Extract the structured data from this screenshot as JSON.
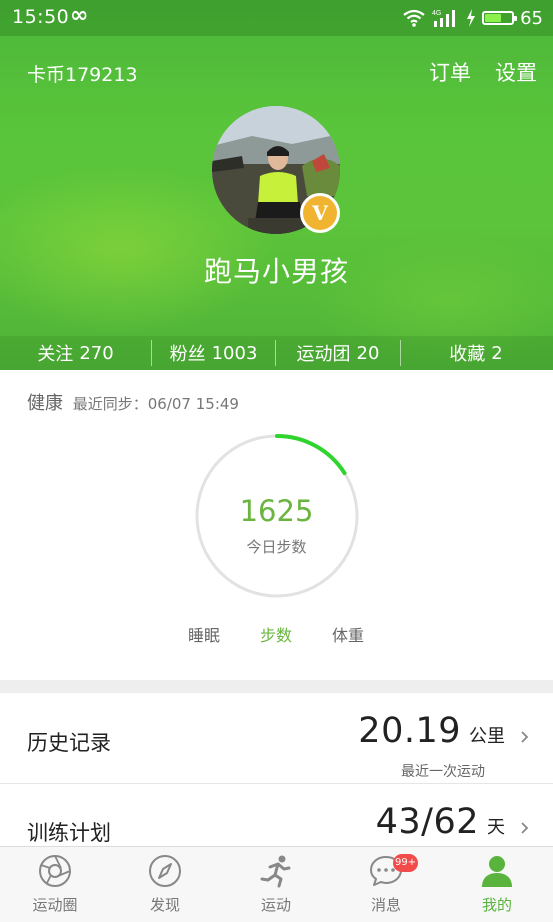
{
  "status_bar": {
    "time": "15:50",
    "infinity_glyph": "∞",
    "network": "4G",
    "battery_level": "65"
  },
  "header": {
    "card_coins": "卡币179213",
    "actions": [
      {
        "label": "订单"
      },
      {
        "label": "设置"
      }
    ],
    "badge_letter": "V",
    "username": "跑马小男孩"
  },
  "stats": [
    {
      "label": "关注",
      "value": "270"
    },
    {
      "label": "粉丝",
      "value": "1003"
    },
    {
      "label": "运动团",
      "value": "20"
    },
    {
      "label": "收藏",
      "value": "2"
    }
  ],
  "health": {
    "title": "健康",
    "sync_text": "最近同步：06/07 15:49",
    "steps_value": "1625",
    "steps_label": "今日步数",
    "ring_progress": 0.16,
    "tabs": [
      {
        "label": "睡眠",
        "active": false
      },
      {
        "label": "步数",
        "active": true
      },
      {
        "label": "体重",
        "active": false
      }
    ]
  },
  "rows": [
    {
      "title": "历史记录",
      "value": "20.19",
      "unit": "公里",
      "subtitle": "最近一次运动"
    },
    {
      "title": "训练计划",
      "value": "43/62",
      "unit": "天"
    }
  ],
  "bottom_nav": [
    {
      "label": "运动圈",
      "icon": "sports-circle-icon",
      "active": false
    },
    {
      "label": "发现",
      "icon": "compass-icon",
      "active": false
    },
    {
      "label": "运动",
      "icon": "runner-icon",
      "active": false
    },
    {
      "label": "消息",
      "icon": "chat-bubble-icon",
      "active": false,
      "badge": "99+"
    },
    {
      "label": "我的",
      "icon": "person-icon",
      "active": true
    }
  ],
  "colors": {
    "brand_green": "#59c53a",
    "active_green": "#6ab53f",
    "badge_gold": "#f1b431",
    "badge_red": "#f24b4b"
  }
}
